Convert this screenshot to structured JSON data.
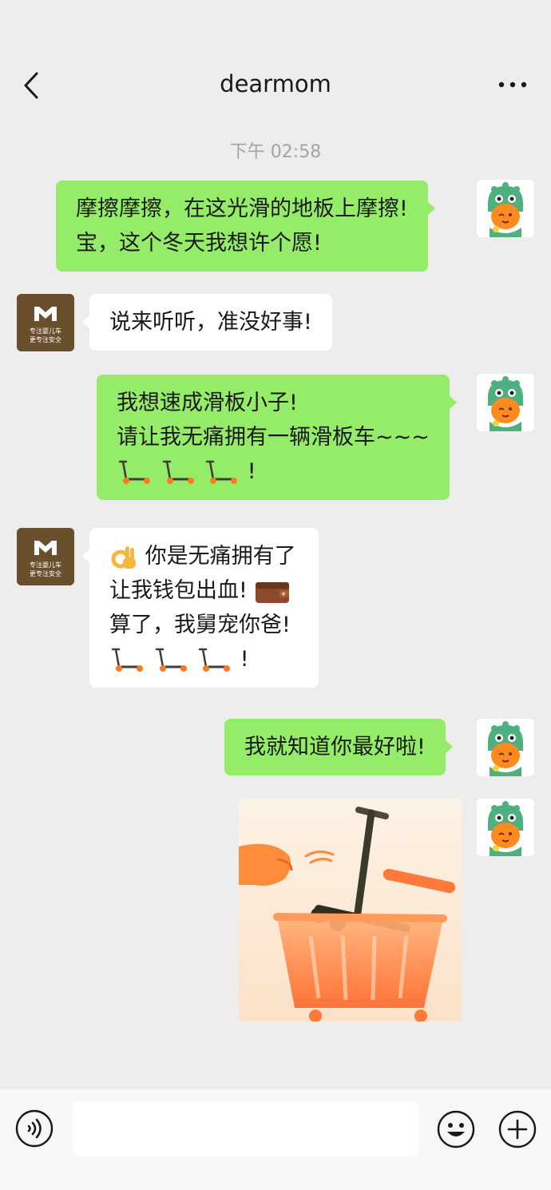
{
  "header": {
    "title": "dearmom"
  },
  "timestamp": "下午 02:58",
  "messages": {
    "m1": {
      "line1": "摩擦摩擦，在这光滑的地板上摩擦!",
      "line2": "宝，这个冬天我想许个愿!"
    },
    "m2": {
      "line1": "说来听听，准没好事!"
    },
    "m3": {
      "line1": "我想速成滑板小子!",
      "line2": "请让我无痛拥有一辆滑板车~~~",
      "line3_suffix": "!"
    },
    "m4": {
      "line1": "你是无痛拥有了",
      "line2": "让我钱包出血!",
      "line3": "算了，我舅宠你爸!",
      "line4_suffix": "!"
    },
    "m5": {
      "line1": "我就知道你最好啦!"
    }
  },
  "brand_avatar": {
    "line1": "专注婴儿车",
    "line2": "更专注安全"
  },
  "icons": {
    "back": "chevron-left-icon",
    "more": "more-dots-icon",
    "voice": "voice-icon",
    "emoji": "emoji-icon",
    "plus": "plus-icon",
    "scooter": "kick-scooter-emoji",
    "ok_hand": "ok-hand-emoji",
    "wallet": "wallet-emoji"
  },
  "colors": {
    "bubble_me": "#95ec69",
    "bubble_them": "#ffffff",
    "background": "#ededed"
  }
}
